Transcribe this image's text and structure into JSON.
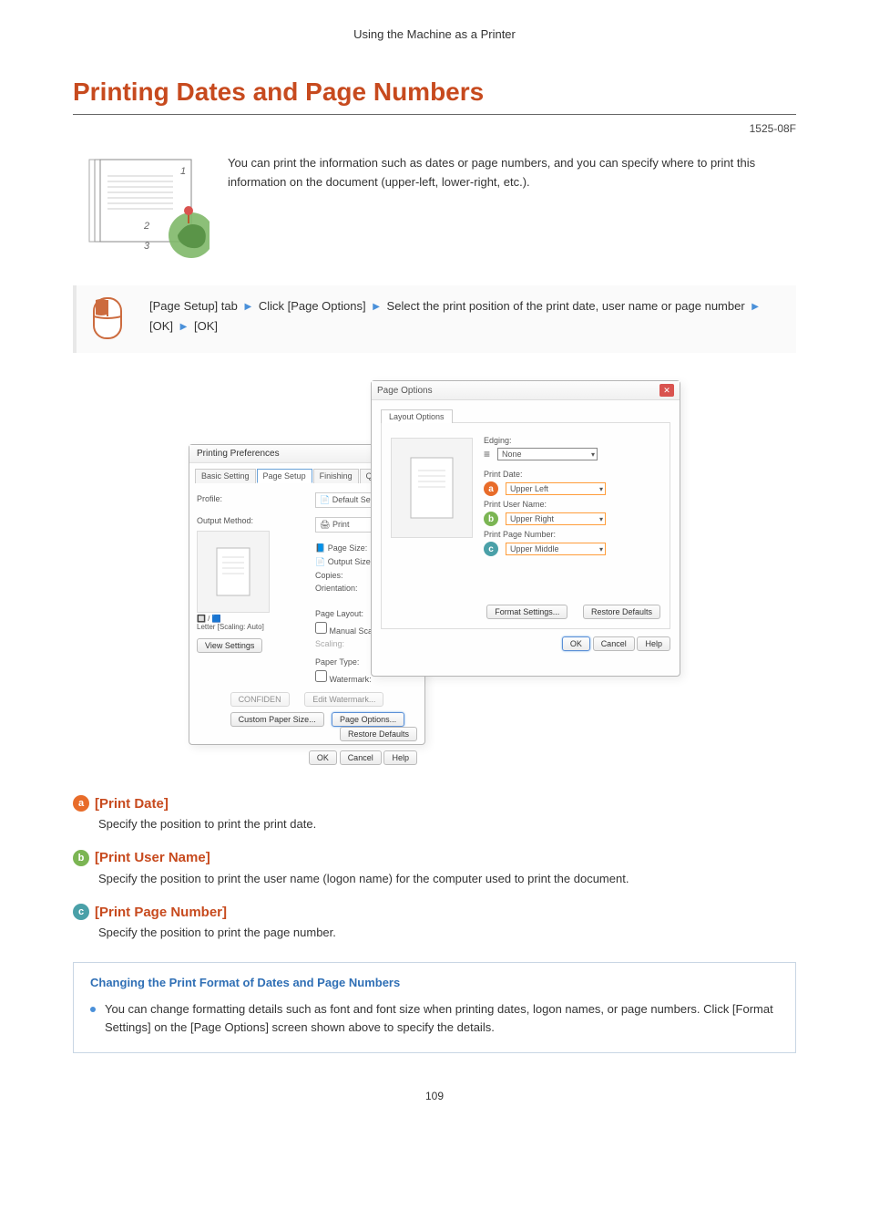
{
  "chapter": "Using the Machine as a Printer",
  "heading": "Printing Dates and Page Numbers",
  "code_id": "1525-08F",
  "intro": "You can print the information such as dates or page numbers, and you can specify where to print this information on the document (upper-left, lower-right, etc.).",
  "proc": {
    "seg1": "[Page Setup] tab",
    "seg2": "Click [Page Options]",
    "seg3": "Select the print position of the print date, user name or page number",
    "seg4": "[OK]",
    "seg5": "[OK]"
  },
  "prefs_dialog": {
    "title": "Printing Preferences",
    "tabs": [
      "Basic Setting",
      "Page Setup",
      "Finishing",
      "Quality"
    ],
    "selected_tab_index": 1,
    "labels": {
      "profile": "Profile:",
      "profile_val": "Default Settings",
      "output_method": "Output Method:",
      "output_method_val": "Print",
      "page_size": "Page Size:",
      "output_size": "Output Size:",
      "copies": "Copies:",
      "orientation": "Orientation:",
      "page_layout": "Page Layout:",
      "manual_scaling": "Manual Scaling",
      "scaling": "Scaling:",
      "paper_type": "Paper Type:",
      "watermark": "Watermark:"
    },
    "preview_caption": "Letter [Scaling: Auto]",
    "buttons": {
      "view_settings": "View Settings",
      "custom_paper": "Custom Paper Size...",
      "page_options": "Page Options...",
      "restore": "Restore Defaults",
      "confidential": "CONFIDEN",
      "edit_wm": "Edit Watermark...",
      "ok": "OK",
      "cancel": "Cancel",
      "help": "Help"
    }
  },
  "opts_dialog": {
    "title": "Page Options",
    "tab": "Layout Options",
    "labels": {
      "edging": "Edging:",
      "edging_val": "None",
      "print_date": "Print Date:",
      "print_date_val": "Upper Left",
      "print_user": "Print User Name:",
      "print_user_val": "Upper Right",
      "print_page": "Print Page Number:",
      "print_page_val": "Upper Middle"
    },
    "buttons": {
      "format": "Format Settings...",
      "restore": "Restore Defaults",
      "ok": "OK",
      "cancel": "Cancel",
      "help": "Help"
    }
  },
  "sections": {
    "a": {
      "title": "[Print Date]",
      "desc": "Specify the position to print the print date."
    },
    "b": {
      "title": "[Print User Name]",
      "desc": "Specify the position to print the user name (logon name) for the computer used to print the document."
    },
    "c": {
      "title": "[Print Page Number]",
      "desc": "Specify the position to print the page number."
    }
  },
  "note": {
    "title": "Changing the Print Format of Dates and Page Numbers",
    "body": "You can change formatting details such as font and font size when printing dates, logon names, or page numbers. Click [Format Settings] on the [Page Options] screen shown above to specify the details."
  },
  "page_number": "109"
}
